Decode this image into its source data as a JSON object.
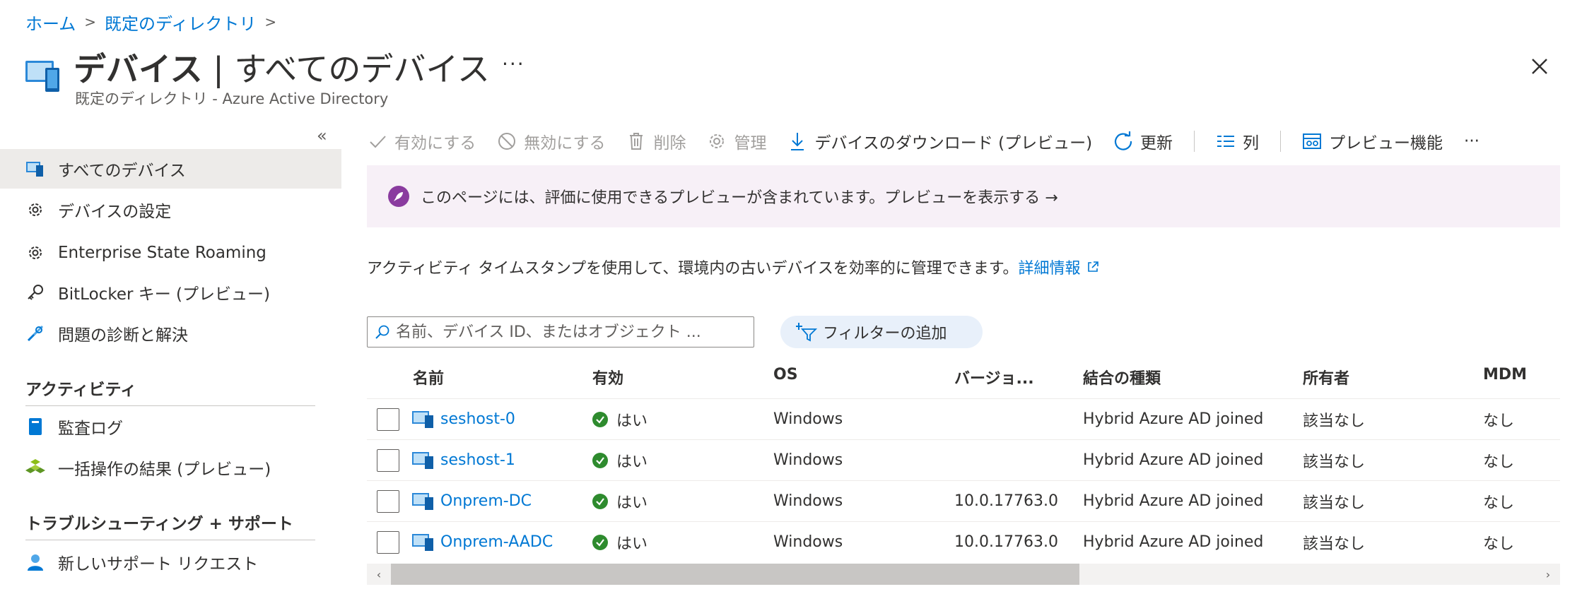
{
  "breadcrumb": {
    "home": "ホーム",
    "directory": "既定のディレクトリ"
  },
  "header": {
    "title_main": "デバイス",
    "title_sep": " | ",
    "title_sub": "すべてのデバイス",
    "more": "···",
    "subtitle": "既定のディレクトリ - Azure Active Directory"
  },
  "nav": {
    "collapse": "«",
    "items": [
      {
        "label": "すべてのデバイス",
        "icon": "devices-icon"
      },
      {
        "label": "デバイスの設定",
        "icon": "gear-icon"
      },
      {
        "label": "Enterprise State Roaming",
        "icon": "gear-icon"
      },
      {
        "label": "BitLocker キー (プレビュー)",
        "icon": "key-icon"
      },
      {
        "label": "問題の診断と解決",
        "icon": "wrench-icon"
      }
    ],
    "section_activity": "アクティビティ",
    "activity_items": [
      {
        "label": "監査ログ",
        "icon": "book-icon"
      },
      {
        "label": "一括操作の結果 (プレビュー)",
        "icon": "bulk-icon"
      }
    ],
    "section_support": "トラブルシューティング + サポート",
    "support_items": [
      {
        "label": "新しいサポート リクエスト",
        "icon": "support-person-icon"
      }
    ]
  },
  "toolbar": {
    "enable": "有効にする",
    "disable": "無効にする",
    "delete": "削除",
    "manage": "管理",
    "download": "デバイスのダウンロード (プレビュー)",
    "refresh": "更新",
    "columns": "列",
    "preview": "プレビュー機能",
    "more": "···"
  },
  "banner": {
    "text": "このページには、評価に使用できるプレビューが含まれています。プレビューを表示する →"
  },
  "info": {
    "text": "アクティビティ タイムスタンプを使用して、環境内の古いデバイスを効率的に管理できます。",
    "link": "詳細情報"
  },
  "search": {
    "placeholder": "名前、デバイス ID、またはオブジェクト ..."
  },
  "filter": {
    "label": "フィルターの追加"
  },
  "table": {
    "headers": [
      "名前",
      "有効",
      "OS",
      "バージョ...",
      "結合の種類",
      "所有者",
      "MDM"
    ],
    "rows": [
      {
        "name": "seshost-0",
        "enabled": "はい",
        "os": "Windows",
        "version": "",
        "join": "Hybrid Azure AD joined",
        "owner": "該当なし",
        "mdm": "なし"
      },
      {
        "name": "seshost-1",
        "enabled": "はい",
        "os": "Windows",
        "version": "",
        "join": "Hybrid Azure AD joined",
        "owner": "該当なし",
        "mdm": "なし"
      },
      {
        "name": "Onprem-DC",
        "enabled": "はい",
        "os": "Windows",
        "version": "10.0.17763.0",
        "join": "Hybrid Azure AD joined",
        "owner": "該当なし",
        "mdm": "なし"
      },
      {
        "name": "Onprem-AADC",
        "enabled": "はい",
        "os": "Windows",
        "version": "10.0.17763.0",
        "join": "Hybrid Azure AD joined",
        "owner": "該当なし",
        "mdm": "なし"
      }
    ]
  },
  "scrollbar": {
    "left": "‹",
    "right": "›"
  },
  "colors": {
    "accent": "#0078d4",
    "nav_active": "#edebe9",
    "banner_bg": "#f7f0f7",
    "success": "#2e8b2e",
    "rocket": "#8a3b9f"
  }
}
